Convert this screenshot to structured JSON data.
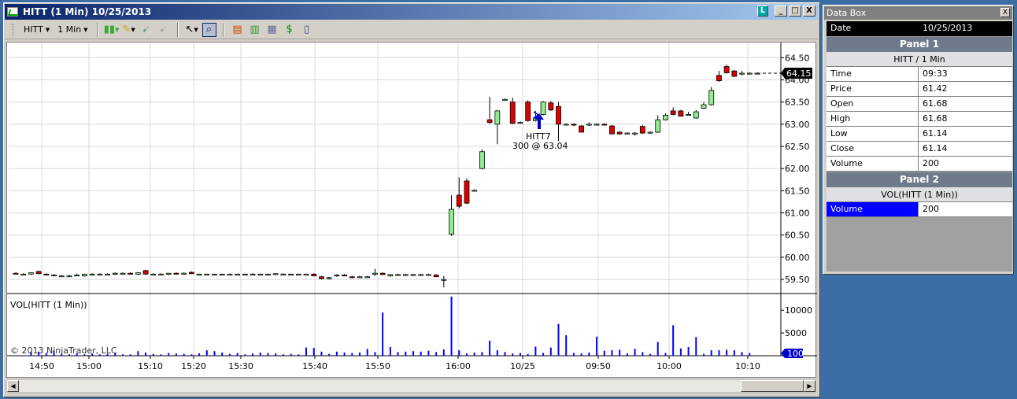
{
  "window": {
    "title": "HITT (1 Min)  10/25/2013",
    "buttons": [
      "_",
      "□",
      "X"
    ]
  },
  "toolbar": {
    "instrument": "HITT",
    "interval": "1 Min",
    "icons": [
      "chart-style-icon",
      "drawing-pencil-icon",
      "trade-arrow-icon",
      "disabled-tool-icon",
      "pointer-icon",
      "zoom-icon",
      "strategies-icon",
      "indicators-icon",
      "chart-properties-icon",
      "currency-icon",
      "data-box-icon"
    ]
  },
  "chart": {
    "price_ticks": [
      "64.50",
      "64.00",
      "63.50",
      "63.00",
      "62.50",
      "62.00",
      "61.50",
      "61.00",
      "60.50",
      "60.00",
      "59.50"
    ],
    "last_price_label": "64.15",
    "volume_ticks": [
      "10000",
      "5000"
    ],
    "last_volume_label": "100",
    "volume_title": "VOL(HITT (1 Min))",
    "copyright": "© 2013 NinjaTrader, LLC",
    "time_labels": [
      "14:50",
      "15:00",
      "15:10",
      "15:20",
      "15:30",
      "15:40",
      "15:50",
      "16:00",
      "10/25",
      "09:50",
      "10:00",
      "10:10"
    ],
    "execution": {
      "name": "HITT7",
      "text": "300 @ 63.04"
    },
    "colors": {
      "up": "#90ee90",
      "down": "#dd0000",
      "volume": "#0000ff",
      "grid": "#d8d8d8"
    }
  },
  "chart_data": {
    "type": "candlestick",
    "instrument": "HITT",
    "interval": "1 Min",
    "price_range": [
      59.2,
      64.7
    ],
    "volume_range": [
      0,
      13500
    ],
    "candles": [
      {
        "o": 59.64,
        "h": 59.66,
        "l": 59.62,
        "c": 59.62
      },
      {
        "o": 59.62,
        "h": 59.64,
        "l": 59.6,
        "c": 59.62
      },
      {
        "o": 59.62,
        "h": 59.66,
        "l": 59.6,
        "c": 59.65
      },
      {
        "o": 59.68,
        "h": 59.7,
        "l": 59.62,
        "c": 59.63
      },
      {
        "o": 59.62,
        "h": 59.64,
        "l": 59.6,
        "c": 59.6
      },
      {
        "o": 59.6,
        "h": 59.62,
        "l": 59.58,
        "c": 59.6
      },
      {
        "o": 59.58,
        "h": 59.6,
        "l": 59.56,
        "c": 59.58
      },
      {
        "o": 59.58,
        "h": 59.6,
        "l": 59.56,
        "c": 59.58
      },
      {
        "o": 59.6,
        "h": 59.63,
        "l": 59.58,
        "c": 59.6
      },
      {
        "o": 59.58,
        "h": 59.62,
        "l": 59.56,
        "c": 59.62
      },
      {
        "o": 59.62,
        "h": 59.64,
        "l": 59.6,
        "c": 59.62
      },
      {
        "o": 59.62,
        "h": 59.64,
        "l": 59.6,
        "c": 59.62
      },
      {
        "o": 59.62,
        "h": 59.64,
        "l": 59.6,
        "c": 59.62
      },
      {
        "o": 59.62,
        "h": 59.66,
        "l": 59.6,
        "c": 59.64
      },
      {
        "o": 59.64,
        "h": 59.66,
        "l": 59.62,
        "c": 59.64
      },
      {
        "o": 59.64,
        "h": 59.66,
        "l": 59.62,
        "c": 59.63
      },
      {
        "o": 59.62,
        "h": 59.66,
        "l": 59.6,
        "c": 59.65
      },
      {
        "o": 59.7,
        "h": 59.72,
        "l": 59.6,
        "c": 59.62
      },
      {
        "o": 59.62,
        "h": 59.64,
        "l": 59.6,
        "c": 59.62
      },
      {
        "o": 59.62,
        "h": 59.64,
        "l": 59.6,
        "c": 59.62
      },
      {
        "o": 59.62,
        "h": 59.64,
        "l": 59.6,
        "c": 59.64
      },
      {
        "o": 59.64,
        "h": 59.66,
        "l": 59.62,
        "c": 59.63
      },
      {
        "o": 59.64,
        "h": 59.66,
        "l": 59.62,
        "c": 59.64
      },
      {
        "o": 59.66,
        "h": 59.68,
        "l": 59.62,
        "c": 59.63
      },
      {
        "o": 59.62,
        "h": 59.63,
        "l": 59.6,
        "c": 59.62
      },
      {
        "o": 59.62,
        "h": 59.63,
        "l": 59.6,
        "c": 59.62
      },
      {
        "o": 59.62,
        "h": 59.63,
        "l": 59.6,
        "c": 59.62
      },
      {
        "o": 59.62,
        "h": 59.63,
        "l": 59.6,
        "c": 59.62
      },
      {
        "o": 59.62,
        "h": 59.63,
        "l": 59.6,
        "c": 59.62
      },
      {
        "o": 59.62,
        "h": 59.63,
        "l": 59.6,
        "c": 59.62
      },
      {
        "o": 59.62,
        "h": 59.63,
        "l": 59.6,
        "c": 59.62
      },
      {
        "o": 59.62,
        "h": 59.64,
        "l": 59.6,
        "c": 59.62
      },
      {
        "o": 59.62,
        "h": 59.63,
        "l": 59.6,
        "c": 59.62
      },
      {
        "o": 59.62,
        "h": 59.63,
        "l": 59.6,
        "c": 59.62
      },
      {
        "o": 59.62,
        "h": 59.64,
        "l": 59.6,
        "c": 59.63
      },
      {
        "o": 59.62,
        "h": 59.64,
        "l": 59.6,
        "c": 59.62
      },
      {
        "o": 59.62,
        "h": 59.63,
        "l": 59.6,
        "c": 59.62
      },
      {
        "o": 59.62,
        "h": 59.63,
        "l": 59.6,
        "c": 59.62
      },
      {
        "o": 59.62,
        "h": 59.63,
        "l": 59.6,
        "c": 59.62
      },
      {
        "o": 59.62,
        "h": 59.64,
        "l": 59.58,
        "c": 59.58
      },
      {
        "o": 59.56,
        "h": 59.58,
        "l": 59.5,
        "c": 59.52
      },
      {
        "o": 59.54,
        "h": 59.56,
        "l": 59.5,
        "c": 59.54
      },
      {
        "o": 59.58,
        "h": 59.62,
        "l": 59.56,
        "c": 59.6
      },
      {
        "o": 59.6,
        "h": 59.62,
        "l": 59.58,
        "c": 59.58
      },
      {
        "o": 59.56,
        "h": 59.58,
        "l": 59.54,
        "c": 59.54
      },
      {
        "o": 59.56,
        "h": 59.58,
        "l": 59.54,
        "c": 59.56
      },
      {
        "o": 59.56,
        "h": 59.58,
        "l": 59.54,
        "c": 59.56
      },
      {
        "o": 59.64,
        "h": 59.74,
        "l": 59.58,
        "c": 59.64
      },
      {
        "o": 59.64,
        "h": 59.66,
        "l": 59.6,
        "c": 59.61
      },
      {
        "o": 59.58,
        "h": 59.62,
        "l": 59.56,
        "c": 59.61
      },
      {
        "o": 59.61,
        "h": 59.63,
        "l": 59.59,
        "c": 59.61
      },
      {
        "o": 59.61,
        "h": 59.63,
        "l": 59.59,
        "c": 59.61
      },
      {
        "o": 59.61,
        "h": 59.63,
        "l": 59.59,
        "c": 59.61
      },
      {
        "o": 59.61,
        "h": 59.63,
        "l": 59.59,
        "c": 59.61
      },
      {
        "o": 59.61,
        "h": 59.63,
        "l": 59.59,
        "c": 59.61
      },
      {
        "o": 59.6,
        "h": 59.62,
        "l": 59.56,
        "c": 59.56
      },
      {
        "o": 59.5,
        "h": 59.58,
        "l": 59.32,
        "c": 59.5
      },
      {
        "o": 60.52,
        "h": 61.4,
        "l": 60.48,
        "c": 61.08
      },
      {
        "o": 61.4,
        "h": 61.8,
        "l": 61.1,
        "c": 61.15
      },
      {
        "o": 61.72,
        "h": 61.78,
        "l": 61.2,
        "c": 61.22
      },
      {
        "o": 61.51,
        "h": 61.53,
        "l": 61.49,
        "c": 61.51
      },
      {
        "o": 62.0,
        "h": 62.43,
        "l": 61.98,
        "c": 62.38
      },
      {
        "o": 63.1,
        "h": 63.62,
        "l": 63.0,
        "c": 63.04
      },
      {
        "o": 63.0,
        "h": 63.32,
        "l": 62.55,
        "c": 63.3
      },
      {
        "o": 63.56,
        "h": 63.58,
        "l": 63.54,
        "c": 63.56
      },
      {
        "o": 63.5,
        "h": 63.6,
        "l": 63.0,
        "c": 63.02
      },
      {
        "o": 63.04,
        "h": 63.06,
        "l": 63.02,
        "c": 63.04
      },
      {
        "o": 63.5,
        "h": 63.54,
        "l": 63.06,
        "c": 63.08
      },
      {
        "o": 63.08,
        "h": 63.3,
        "l": 63.06,
        "c": 63.14
      },
      {
        "o": 63.22,
        "h": 63.52,
        "l": 63.2,
        "c": 63.5
      },
      {
        "o": 63.48,
        "h": 63.52,
        "l": 63.3,
        "c": 63.32
      },
      {
        "o": 63.4,
        "h": 63.5,
        "l": 62.62,
        "c": 63.0
      },
      {
        "o": 63.0,
        "h": 63.02,
        "l": 62.98,
        "c": 63.0
      },
      {
        "o": 63.0,
        "h": 63.02,
        "l": 62.96,
        "c": 62.98
      },
      {
        "o": 62.96,
        "h": 62.98,
        "l": 62.84,
        "c": 62.82
      },
      {
        "o": 62.98,
        "h": 63.04,
        "l": 62.96,
        "c": 63.0
      },
      {
        "o": 63.0,
        "h": 63.02,
        "l": 62.98,
        "c": 63.0
      },
      {
        "o": 63.0,
        "h": 63.02,
        "l": 62.98,
        "c": 62.98
      },
      {
        "o": 62.96,
        "h": 62.98,
        "l": 62.78,
        "c": 62.78
      },
      {
        "o": 62.82,
        "h": 62.84,
        "l": 62.76,
        "c": 62.78
      },
      {
        "o": 62.8,
        "h": 62.82,
        "l": 62.78,
        "c": 62.8
      },
      {
        "o": 62.8,
        "h": 62.82,
        "l": 62.74,
        "c": 62.8
      },
      {
        "o": 62.95,
        "h": 62.98,
        "l": 62.78,
        "c": 62.8
      },
      {
        "o": 62.8,
        "h": 62.84,
        "l": 62.78,
        "c": 62.82
      },
      {
        "o": 62.82,
        "h": 63.2,
        "l": 62.8,
        "c": 63.1
      },
      {
        "o": 63.1,
        "h": 63.24,
        "l": 63.08,
        "c": 63.2
      },
      {
        "o": 63.3,
        "h": 63.38,
        "l": 63.2,
        "c": 63.22
      },
      {
        "o": 63.3,
        "h": 63.32,
        "l": 63.18,
        "c": 63.18
      },
      {
        "o": 63.22,
        "h": 63.28,
        "l": 63.2,
        "c": 63.22
      },
      {
        "o": 63.14,
        "h": 63.32,
        "l": 63.12,
        "c": 63.28
      },
      {
        "o": 63.36,
        "h": 63.5,
        "l": 63.34,
        "c": 63.44
      },
      {
        "o": 63.44,
        "h": 63.84,
        "l": 63.42,
        "c": 63.76
      },
      {
        "o": 64.1,
        "h": 64.2,
        "l": 63.95,
        "c": 63.98
      },
      {
        "o": 64.3,
        "h": 64.34,
        "l": 64.14,
        "c": 64.16
      },
      {
        "o": 64.2,
        "h": 64.22,
        "l": 64.06,
        "c": 64.08
      },
      {
        "o": 64.15,
        "h": 64.2,
        "l": 64.1,
        "c": 64.15
      },
      {
        "o": 64.15,
        "h": 64.17,
        "l": 64.13,
        "c": 64.15
      },
      {
        "o": 64.15,
        "h": 64.17,
        "l": 64.13,
        "c": 64.15
      }
    ],
    "volume": [
      60,
      80,
      900,
      900,
      600,
      1100,
      400,
      300,
      500,
      300,
      500,
      300,
      400,
      600,
      300,
      300,
      1000,
      700,
      400,
      300,
      600,
      500,
      400,
      300,
      500,
      1200,
      1000,
      700,
      400,
      600,
      300,
      500,
      700,
      600,
      500,
      300,
      400,
      300,
      1800,
      1700,
      900,
      400,
      900,
      700,
      600,
      700,
      1500,
      800,
      9500,
      1900,
      800,
      900,
      1000,
      900,
      1100,
      800,
      1400,
      13000,
      1200,
      500,
      700,
      800,
      3300,
      1200,
      800,
      500,
      600,
      400,
      2000,
      600,
      1800,
      7000,
      4500,
      600,
      500,
      700,
      4200,
      1100,
      1200,
      1300,
      500,
      1500,
      800,
      400,
      3000,
      600,
      6700,
      1600,
      1900,
      4100,
      400,
      1200,
      1200,
      1300,
      1200,
      800,
      600
    ],
    "price_ticks": [
      64.5,
      64.0,
      63.5,
      63.0,
      62.5,
      62.0,
      61.5,
      61.0,
      60.5,
      60.0,
      59.5
    ],
    "volume_ticks": [
      10000,
      5000
    ],
    "last_price": 64.15,
    "last_volume": 100,
    "grid": true
  },
  "databox": {
    "title": "Data Box",
    "close_label": "X",
    "date_label": "Date",
    "date_value": "10/25/2013",
    "panel1_label": "Panel 1",
    "panel1_sub": "HITT / 1 Min",
    "rows": [
      {
        "k": "Time",
        "v": "09:33"
      },
      {
        "k": "Price",
        "v": "61.42"
      },
      {
        "k": "Open",
        "v": "61.68"
      },
      {
        "k": "High",
        "v": "61.68"
      },
      {
        "k": "Low",
        "v": "61.14"
      },
      {
        "k": "Close",
        "v": "61.14"
      },
      {
        "k": "Volume",
        "v": "200"
      }
    ],
    "panel2_label": "Panel 2",
    "panel2_sub": "VOL(HITT (1 Min))",
    "vol_key": "Volume",
    "vol_value": "200"
  }
}
